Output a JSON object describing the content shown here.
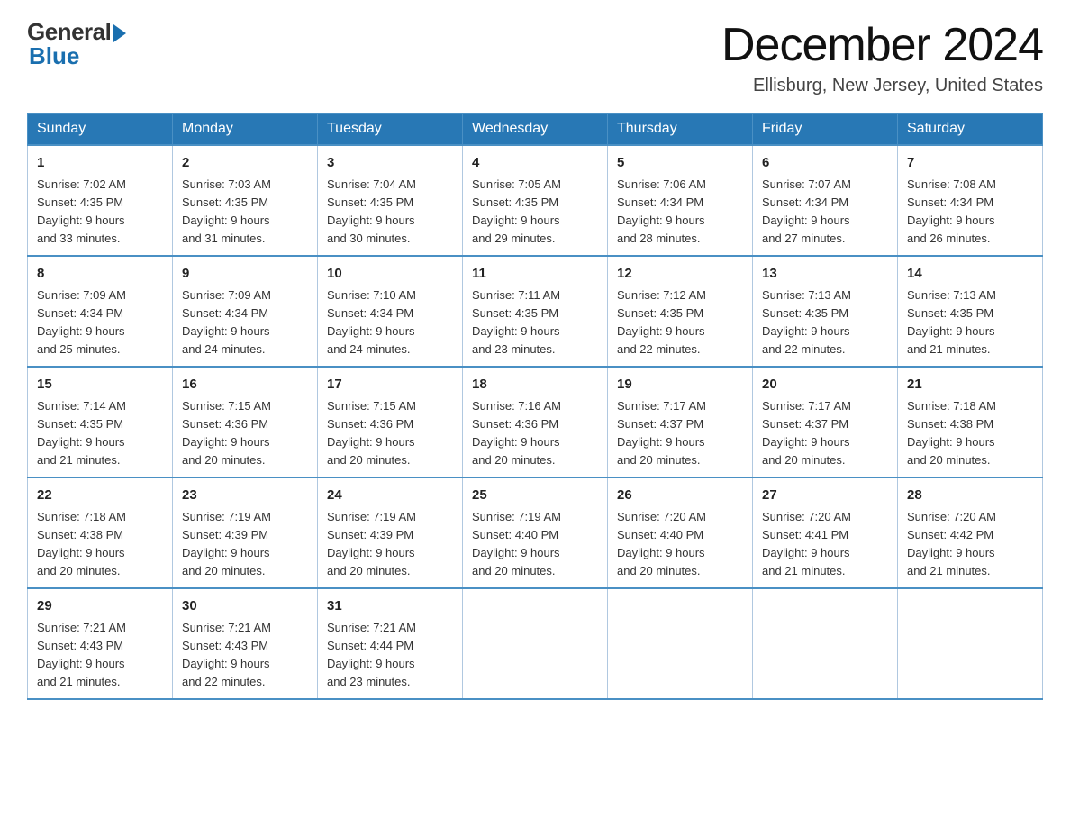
{
  "logo": {
    "general": "General",
    "blue": "Blue"
  },
  "title": {
    "month_year": "December 2024",
    "location": "Ellisburg, New Jersey, United States"
  },
  "days_of_week": [
    "Sunday",
    "Monday",
    "Tuesday",
    "Wednesday",
    "Thursday",
    "Friday",
    "Saturday"
  ],
  "weeks": [
    [
      {
        "day": "1",
        "sunrise": "7:02 AM",
        "sunset": "4:35 PM",
        "daylight": "9 hours and 33 minutes."
      },
      {
        "day": "2",
        "sunrise": "7:03 AM",
        "sunset": "4:35 PM",
        "daylight": "9 hours and 31 minutes."
      },
      {
        "day": "3",
        "sunrise": "7:04 AM",
        "sunset": "4:35 PM",
        "daylight": "9 hours and 30 minutes."
      },
      {
        "day": "4",
        "sunrise": "7:05 AM",
        "sunset": "4:35 PM",
        "daylight": "9 hours and 29 minutes."
      },
      {
        "day": "5",
        "sunrise": "7:06 AM",
        "sunset": "4:34 PM",
        "daylight": "9 hours and 28 minutes."
      },
      {
        "day": "6",
        "sunrise": "7:07 AM",
        "sunset": "4:34 PM",
        "daylight": "9 hours and 27 minutes."
      },
      {
        "day": "7",
        "sunrise": "7:08 AM",
        "sunset": "4:34 PM",
        "daylight": "9 hours and 26 minutes."
      }
    ],
    [
      {
        "day": "8",
        "sunrise": "7:09 AM",
        "sunset": "4:34 PM",
        "daylight": "9 hours and 25 minutes."
      },
      {
        "day": "9",
        "sunrise": "7:09 AM",
        "sunset": "4:34 PM",
        "daylight": "9 hours and 24 minutes."
      },
      {
        "day": "10",
        "sunrise": "7:10 AM",
        "sunset": "4:34 PM",
        "daylight": "9 hours and 24 minutes."
      },
      {
        "day": "11",
        "sunrise": "7:11 AM",
        "sunset": "4:35 PM",
        "daylight": "9 hours and 23 minutes."
      },
      {
        "day": "12",
        "sunrise": "7:12 AM",
        "sunset": "4:35 PM",
        "daylight": "9 hours and 22 minutes."
      },
      {
        "day": "13",
        "sunrise": "7:13 AM",
        "sunset": "4:35 PM",
        "daylight": "9 hours and 22 minutes."
      },
      {
        "day": "14",
        "sunrise": "7:13 AM",
        "sunset": "4:35 PM",
        "daylight": "9 hours and 21 minutes."
      }
    ],
    [
      {
        "day": "15",
        "sunrise": "7:14 AM",
        "sunset": "4:35 PM",
        "daylight": "9 hours and 21 minutes."
      },
      {
        "day": "16",
        "sunrise": "7:15 AM",
        "sunset": "4:36 PM",
        "daylight": "9 hours and 20 minutes."
      },
      {
        "day": "17",
        "sunrise": "7:15 AM",
        "sunset": "4:36 PM",
        "daylight": "9 hours and 20 minutes."
      },
      {
        "day": "18",
        "sunrise": "7:16 AM",
        "sunset": "4:36 PM",
        "daylight": "9 hours and 20 minutes."
      },
      {
        "day": "19",
        "sunrise": "7:17 AM",
        "sunset": "4:37 PM",
        "daylight": "9 hours and 20 minutes."
      },
      {
        "day": "20",
        "sunrise": "7:17 AM",
        "sunset": "4:37 PM",
        "daylight": "9 hours and 20 minutes."
      },
      {
        "day": "21",
        "sunrise": "7:18 AM",
        "sunset": "4:38 PM",
        "daylight": "9 hours and 20 minutes."
      }
    ],
    [
      {
        "day": "22",
        "sunrise": "7:18 AM",
        "sunset": "4:38 PM",
        "daylight": "9 hours and 20 minutes."
      },
      {
        "day": "23",
        "sunrise": "7:19 AM",
        "sunset": "4:39 PM",
        "daylight": "9 hours and 20 minutes."
      },
      {
        "day": "24",
        "sunrise": "7:19 AM",
        "sunset": "4:39 PM",
        "daylight": "9 hours and 20 minutes."
      },
      {
        "day": "25",
        "sunrise": "7:19 AM",
        "sunset": "4:40 PM",
        "daylight": "9 hours and 20 minutes."
      },
      {
        "day": "26",
        "sunrise": "7:20 AM",
        "sunset": "4:40 PM",
        "daylight": "9 hours and 20 minutes."
      },
      {
        "day": "27",
        "sunrise": "7:20 AM",
        "sunset": "4:41 PM",
        "daylight": "9 hours and 21 minutes."
      },
      {
        "day": "28",
        "sunrise": "7:20 AM",
        "sunset": "4:42 PM",
        "daylight": "9 hours and 21 minutes."
      }
    ],
    [
      {
        "day": "29",
        "sunrise": "7:21 AM",
        "sunset": "4:43 PM",
        "daylight": "9 hours and 21 minutes."
      },
      {
        "day": "30",
        "sunrise": "7:21 AM",
        "sunset": "4:43 PM",
        "daylight": "9 hours and 22 minutes."
      },
      {
        "day": "31",
        "sunrise": "7:21 AM",
        "sunset": "4:44 PM",
        "daylight": "9 hours and 23 minutes."
      },
      null,
      null,
      null,
      null
    ]
  ],
  "labels": {
    "sunrise": "Sunrise: ",
    "sunset": "Sunset: ",
    "daylight": "Daylight: "
  }
}
